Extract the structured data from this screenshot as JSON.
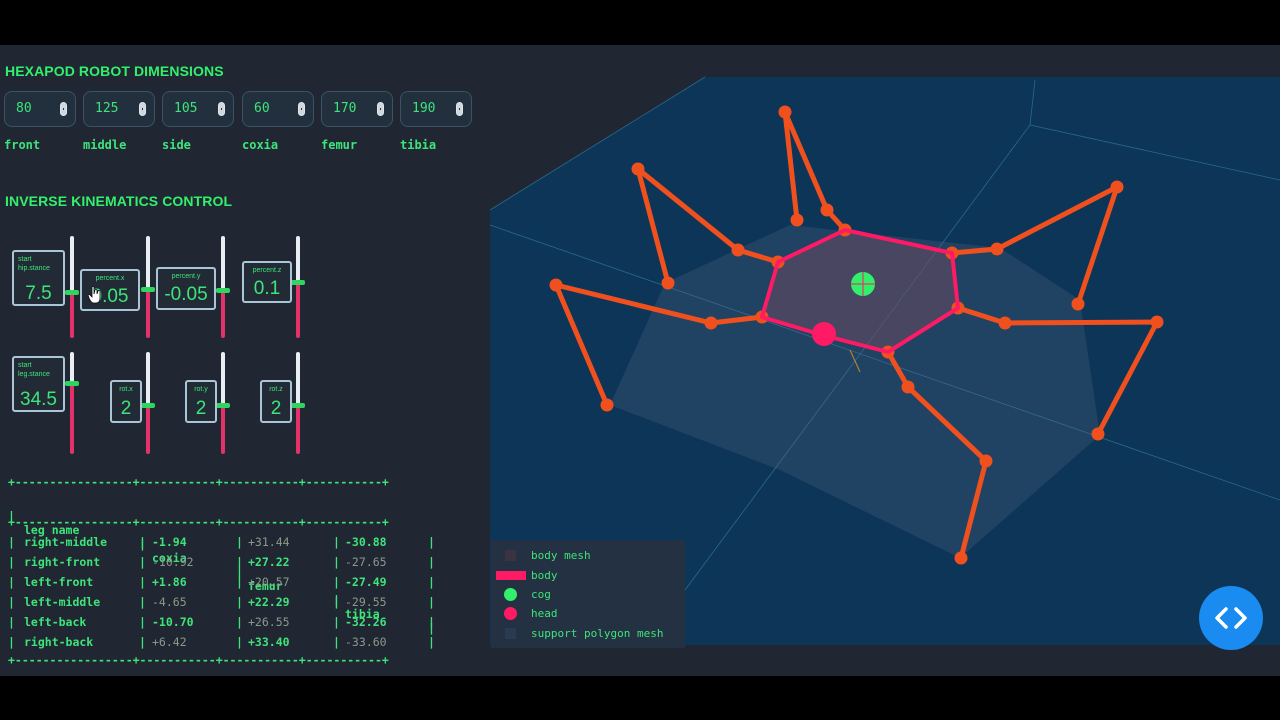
{
  "dimensions": {
    "title": "HEXAPOD ROBOT DIMENSIONS",
    "fields": [
      {
        "label": "front",
        "value": "80"
      },
      {
        "label": "middle",
        "value": "125"
      },
      {
        "label": "side",
        "value": "105"
      },
      {
        "label": "coxia",
        "value": "60"
      },
      {
        "label": "femur",
        "value": "170"
      },
      {
        "label": "tibia",
        "value": "190"
      }
    ]
  },
  "ik": {
    "title": "INVERSE KINEMATICS CONTROL",
    "controls": [
      {
        "label": "start hip.stance",
        "value": "7.5",
        "level": 0.45
      },
      {
        "label": "percent.x",
        "value": "0.05",
        "level": 0.48
      },
      {
        "label": "percent.y",
        "value": "-0.05",
        "level": 0.47
      },
      {
        "label": "percent.z",
        "value": "0.1",
        "level": 0.55
      },
      {
        "label": "start leg.stance",
        "value": "34.5",
        "level": 0.7
      },
      {
        "label": "rot.x",
        "value": "2",
        "level": 0.48
      },
      {
        "label": "rot.y",
        "value": "2",
        "level": 0.48
      },
      {
        "label": "rot.z",
        "value": "2",
        "level": 0.48
      }
    ]
  },
  "table": {
    "border": "+-----------------+-----------+-----------+-----------+",
    "headers": [
      "leg name",
      "coxia",
      "femur",
      "tibia"
    ],
    "rows": [
      {
        "name": "right-middle",
        "coxia": "-1.94",
        "femur": "+31.44",
        "tibia": "-30.88",
        "dim": [
          false,
          true,
          false
        ]
      },
      {
        "name": "right-front",
        "coxia": "-10.92",
        "femur": "+27.22",
        "tibia": "-27.65",
        "dim": [
          true,
          false,
          true
        ]
      },
      {
        "name": "left-front",
        "coxia": "+1.86",
        "femur": "+20.57",
        "tibia": "-27.49",
        "dim": [
          false,
          true,
          false
        ]
      },
      {
        "name": "left-middle",
        "coxia": "-4.65",
        "femur": "+22.29",
        "tibia": "-29.55",
        "dim": [
          true,
          false,
          true
        ]
      },
      {
        "name": "left-back",
        "coxia": "-10.70",
        "femur": "+26.55",
        "tibia": "-32.26",
        "dim": [
          false,
          true,
          false
        ]
      },
      {
        "name": "right-back",
        "coxia": "+6.42",
        "femur": "+33.40",
        "tibia": "-33.60",
        "dim": [
          true,
          false,
          true
        ]
      }
    ]
  },
  "legend": [
    {
      "label": "body mesh",
      "icon": "square",
      "color": "#3a3342"
    },
    {
      "label": "body",
      "icon": "bar",
      "color": "#ff1a66"
    },
    {
      "label": "cog",
      "icon": "dot",
      "color": "#32f06b"
    },
    {
      "label": "head",
      "icon": "dot",
      "color": "#ff1a66"
    },
    {
      "label": "support polygon mesh",
      "icon": "square",
      "color": "#2a3a50"
    }
  ],
  "colors": {
    "accent": "#32f06b",
    "leg": "#f0501e",
    "body": "#ff1a66",
    "floor": "#0c3558"
  },
  "code_button_icon": "code-brackets-icon"
}
